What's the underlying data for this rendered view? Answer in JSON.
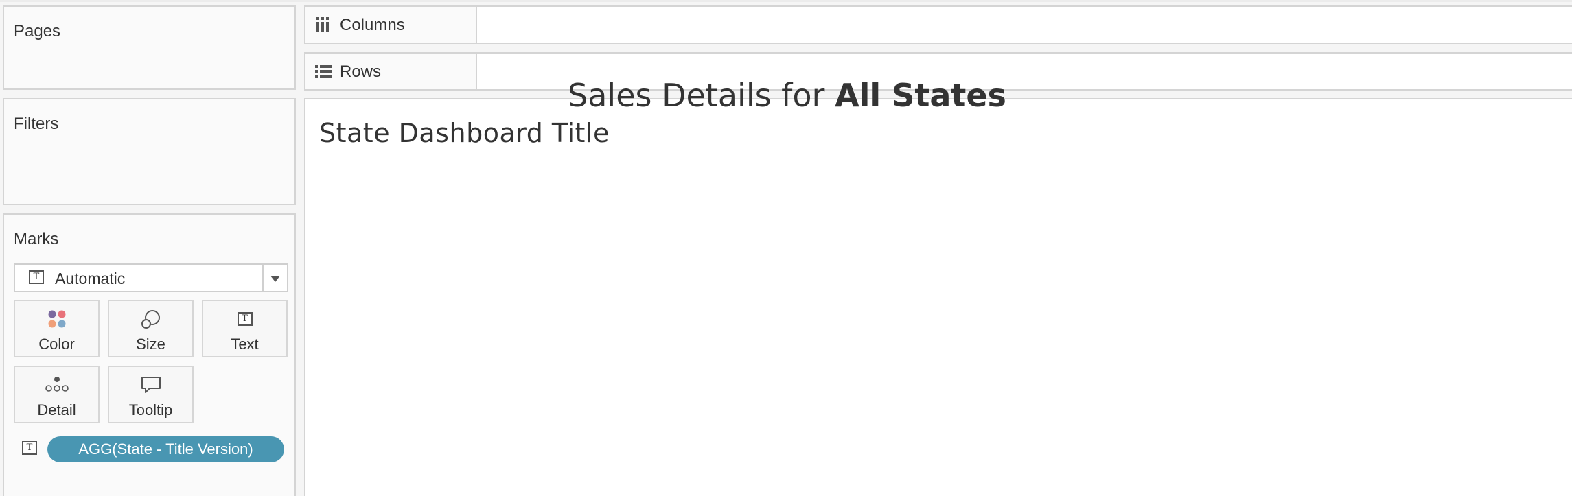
{
  "left_panel": {
    "pages_label": "Pages",
    "filters_label": "Filters",
    "marks": {
      "title": "Marks",
      "mark_type": "Automatic",
      "buttons": {
        "color": "Color",
        "size": "Size",
        "text": "Text",
        "detail": "Detail",
        "tooltip": "Tooltip"
      },
      "text_pill": "AGG(State - Title Version)",
      "text_icon_glyph": "T"
    }
  },
  "shelves": {
    "columns_label": "Columns",
    "rows_label": "Rows"
  },
  "view": {
    "title": "State Dashboard Title",
    "text_prefix": "Sales Details for ",
    "text_bold": "All States"
  },
  "colors": {
    "pill": "#4996b2",
    "color_dots": [
      "#7b6a9f",
      "#e8727a",
      "#f0a07a",
      "#7fa8c9"
    ]
  }
}
